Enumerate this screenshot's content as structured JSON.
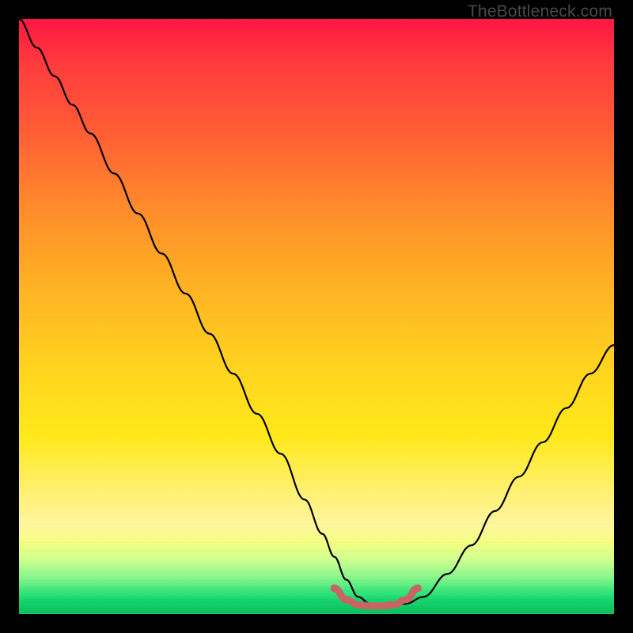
{
  "watermark": "TheBottleneck.com",
  "colors": {
    "curve": "#000000",
    "marker": "#C86464",
    "frame": "#000000"
  },
  "chart_data": {
    "type": "line",
    "title": "",
    "xlabel": "",
    "ylabel": "",
    "xlim": [
      0,
      100
    ],
    "ylim": [
      0,
      104
    ],
    "x": [
      0,
      3,
      6,
      9,
      12,
      16,
      20,
      24,
      28,
      32,
      36,
      40,
      44,
      48,
      51,
      53,
      55,
      57,
      59,
      61,
      63,
      65,
      68,
      72,
      76,
      80,
      84,
      88,
      92,
      96,
      100
    ],
    "values": [
      104,
      99,
      94,
      89,
      84,
      77,
      70,
      63,
      56,
      49,
      42,
      35,
      28,
      20,
      14,
      10,
      6,
      3,
      1.8,
      1.5,
      1.5,
      1.8,
      3,
      7,
      12,
      18,
      24,
      30,
      36,
      42,
      47
    ],
    "marker_region": {
      "x": [
        53,
        55,
        57,
        59,
        61,
        63,
        65,
        67
      ],
      "values": [
        4.5,
        2.5,
        1.6,
        1.4,
        1.4,
        1.6,
        2.5,
        4.5
      ]
    },
    "grid": false,
    "legend": false
  }
}
